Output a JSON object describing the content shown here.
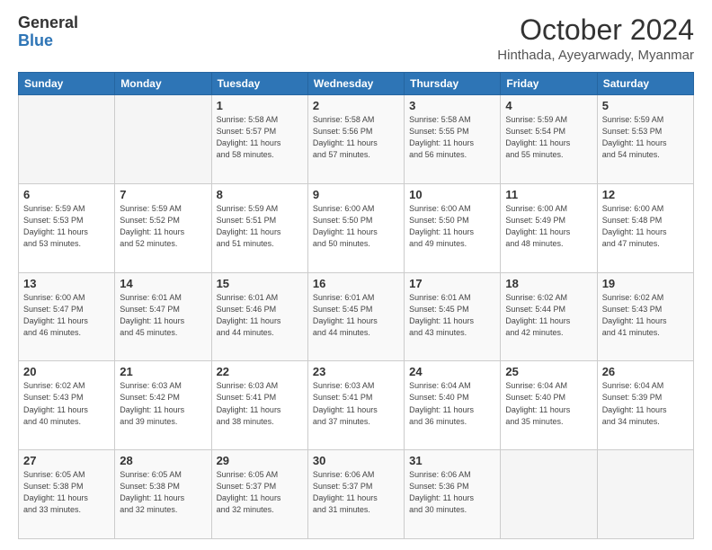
{
  "logo": {
    "line1": "General",
    "line2": "Blue"
  },
  "header": {
    "month": "October 2024",
    "location": "Hinthada, Ayeyarwady, Myanmar"
  },
  "weekdays": [
    "Sunday",
    "Monday",
    "Tuesday",
    "Wednesday",
    "Thursday",
    "Friday",
    "Saturday"
  ],
  "weeks": [
    [
      {
        "day": "",
        "info": ""
      },
      {
        "day": "",
        "info": ""
      },
      {
        "day": "1",
        "info": "Sunrise: 5:58 AM\nSunset: 5:57 PM\nDaylight: 11 hours\nand 58 minutes."
      },
      {
        "day": "2",
        "info": "Sunrise: 5:58 AM\nSunset: 5:56 PM\nDaylight: 11 hours\nand 57 minutes."
      },
      {
        "day": "3",
        "info": "Sunrise: 5:58 AM\nSunset: 5:55 PM\nDaylight: 11 hours\nand 56 minutes."
      },
      {
        "day": "4",
        "info": "Sunrise: 5:59 AM\nSunset: 5:54 PM\nDaylight: 11 hours\nand 55 minutes."
      },
      {
        "day": "5",
        "info": "Sunrise: 5:59 AM\nSunset: 5:53 PM\nDaylight: 11 hours\nand 54 minutes."
      }
    ],
    [
      {
        "day": "6",
        "info": "Sunrise: 5:59 AM\nSunset: 5:53 PM\nDaylight: 11 hours\nand 53 minutes."
      },
      {
        "day": "7",
        "info": "Sunrise: 5:59 AM\nSunset: 5:52 PM\nDaylight: 11 hours\nand 52 minutes."
      },
      {
        "day": "8",
        "info": "Sunrise: 5:59 AM\nSunset: 5:51 PM\nDaylight: 11 hours\nand 51 minutes."
      },
      {
        "day": "9",
        "info": "Sunrise: 6:00 AM\nSunset: 5:50 PM\nDaylight: 11 hours\nand 50 minutes."
      },
      {
        "day": "10",
        "info": "Sunrise: 6:00 AM\nSunset: 5:50 PM\nDaylight: 11 hours\nand 49 minutes."
      },
      {
        "day": "11",
        "info": "Sunrise: 6:00 AM\nSunset: 5:49 PM\nDaylight: 11 hours\nand 48 minutes."
      },
      {
        "day": "12",
        "info": "Sunrise: 6:00 AM\nSunset: 5:48 PM\nDaylight: 11 hours\nand 47 minutes."
      }
    ],
    [
      {
        "day": "13",
        "info": "Sunrise: 6:00 AM\nSunset: 5:47 PM\nDaylight: 11 hours\nand 46 minutes."
      },
      {
        "day": "14",
        "info": "Sunrise: 6:01 AM\nSunset: 5:47 PM\nDaylight: 11 hours\nand 45 minutes."
      },
      {
        "day": "15",
        "info": "Sunrise: 6:01 AM\nSunset: 5:46 PM\nDaylight: 11 hours\nand 44 minutes."
      },
      {
        "day": "16",
        "info": "Sunrise: 6:01 AM\nSunset: 5:45 PM\nDaylight: 11 hours\nand 44 minutes."
      },
      {
        "day": "17",
        "info": "Sunrise: 6:01 AM\nSunset: 5:45 PM\nDaylight: 11 hours\nand 43 minutes."
      },
      {
        "day": "18",
        "info": "Sunrise: 6:02 AM\nSunset: 5:44 PM\nDaylight: 11 hours\nand 42 minutes."
      },
      {
        "day": "19",
        "info": "Sunrise: 6:02 AM\nSunset: 5:43 PM\nDaylight: 11 hours\nand 41 minutes."
      }
    ],
    [
      {
        "day": "20",
        "info": "Sunrise: 6:02 AM\nSunset: 5:43 PM\nDaylight: 11 hours\nand 40 minutes."
      },
      {
        "day": "21",
        "info": "Sunrise: 6:03 AM\nSunset: 5:42 PM\nDaylight: 11 hours\nand 39 minutes."
      },
      {
        "day": "22",
        "info": "Sunrise: 6:03 AM\nSunset: 5:41 PM\nDaylight: 11 hours\nand 38 minutes."
      },
      {
        "day": "23",
        "info": "Sunrise: 6:03 AM\nSunset: 5:41 PM\nDaylight: 11 hours\nand 37 minutes."
      },
      {
        "day": "24",
        "info": "Sunrise: 6:04 AM\nSunset: 5:40 PM\nDaylight: 11 hours\nand 36 minutes."
      },
      {
        "day": "25",
        "info": "Sunrise: 6:04 AM\nSunset: 5:40 PM\nDaylight: 11 hours\nand 35 minutes."
      },
      {
        "day": "26",
        "info": "Sunrise: 6:04 AM\nSunset: 5:39 PM\nDaylight: 11 hours\nand 34 minutes."
      }
    ],
    [
      {
        "day": "27",
        "info": "Sunrise: 6:05 AM\nSunset: 5:38 PM\nDaylight: 11 hours\nand 33 minutes."
      },
      {
        "day": "28",
        "info": "Sunrise: 6:05 AM\nSunset: 5:38 PM\nDaylight: 11 hours\nand 32 minutes."
      },
      {
        "day": "29",
        "info": "Sunrise: 6:05 AM\nSunset: 5:37 PM\nDaylight: 11 hours\nand 32 minutes."
      },
      {
        "day": "30",
        "info": "Sunrise: 6:06 AM\nSunset: 5:37 PM\nDaylight: 11 hours\nand 31 minutes."
      },
      {
        "day": "31",
        "info": "Sunrise: 6:06 AM\nSunset: 5:36 PM\nDaylight: 11 hours\nand 30 minutes."
      },
      {
        "day": "",
        "info": ""
      },
      {
        "day": "",
        "info": ""
      }
    ]
  ]
}
